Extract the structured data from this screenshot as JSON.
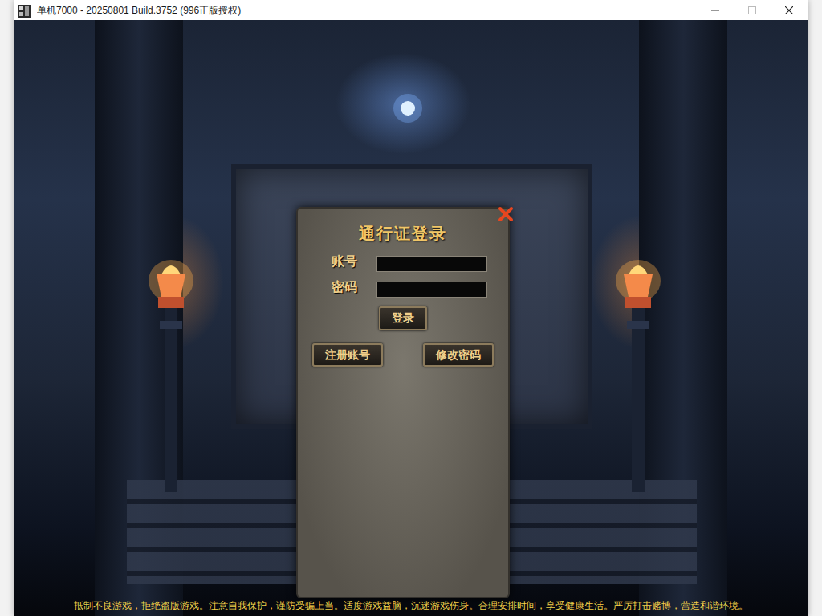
{
  "window": {
    "title": "单机7000 - 20250801 Build.3752 (996正版授权)"
  },
  "login_dialog": {
    "title": "通行证登录",
    "fields": [
      {
        "label": "账号",
        "value": "",
        "focused": true,
        "kind": "text"
      },
      {
        "label": "密码",
        "value": "",
        "focused": false,
        "kind": "password"
      }
    ],
    "login_button": "登录",
    "buttons": [
      "注册账号",
      "修改密码"
    ]
  },
  "notice": "抵制不良游戏，拒绝盗版游戏。注意自我保护，谨防受骗上当。适度游戏益脑，沉迷游戏伤身。合理安排时间，享受健康生活。严厉打击赌博，营造和谐环境。"
}
